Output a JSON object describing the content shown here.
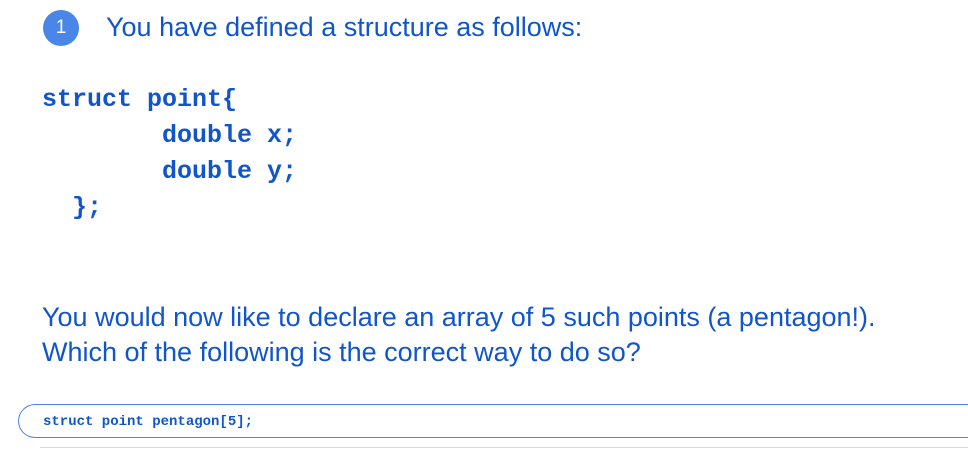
{
  "question": {
    "number": "1",
    "prompt": "You have defined a structure as follows:",
    "code_lines": [
      "struct point{",
      "        double x;",
      "        double y;",
      "  };"
    ],
    "question_lines": [
      "You would now like to declare an array of 5 such points (a pentagon!).",
      "Which of the following is the correct way to do so?"
    ]
  },
  "answers": [
    {
      "label": "struct point pentagon[5];"
    }
  ],
  "colors": {
    "accent": "#1155cc",
    "badge": "#4a86e8",
    "option_border": "#4a86e8",
    "divider": "#d9d9d9",
    "background": "#ffffff"
  },
  "icons": {
    "question_badge": "number-badge"
  }
}
